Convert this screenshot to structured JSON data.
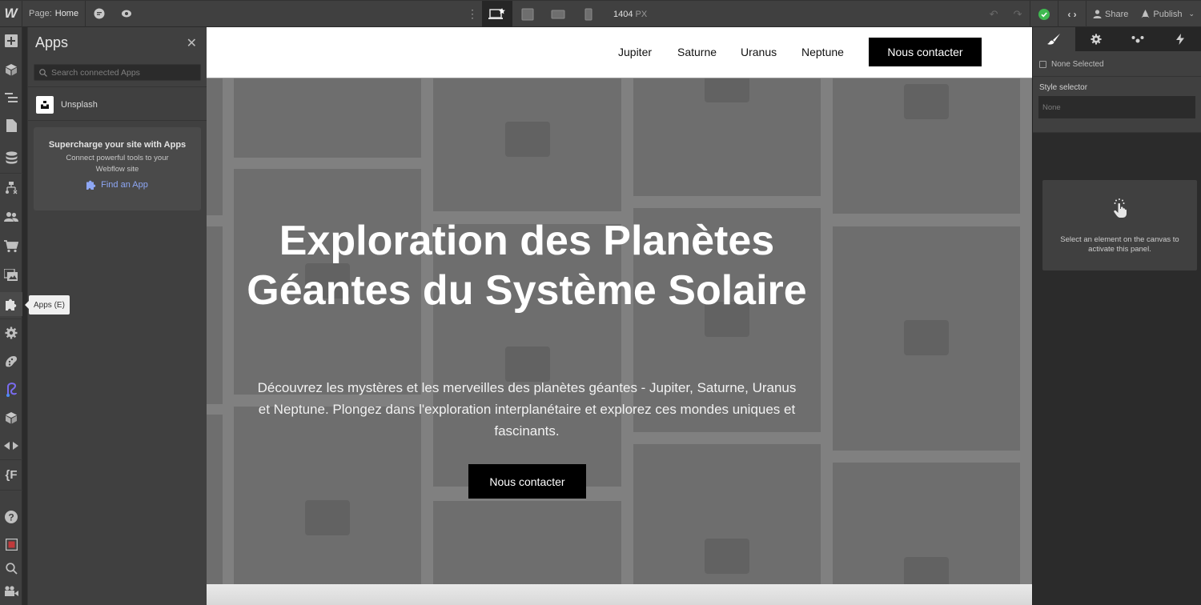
{
  "topbar": {
    "logo": "W",
    "page_label": "Page:",
    "page_name": "Home",
    "breakpoints": [
      {
        "name": "desktop-base",
        "active": true
      },
      {
        "name": "tablet",
        "active": false
      },
      {
        "name": "mobile-landscape",
        "active": false
      },
      {
        "name": "mobile-portrait",
        "active": false
      }
    ],
    "width_value": "1404",
    "width_unit": "PX",
    "share_label": "Share",
    "publish_label": "Publish",
    "status_color": "#3fb950"
  },
  "rail": {
    "items": [
      "add",
      "components",
      "navigator",
      "pages",
      "cms",
      "logic",
      "users",
      "ecommerce",
      "assets",
      "apps",
      "settings",
      "style-guide",
      "audit",
      "3d",
      "code",
      "finsweet",
      "help",
      "record",
      "search",
      "video"
    ],
    "tooltip": "Apps (E)"
  },
  "apps_panel": {
    "title": "Apps",
    "search_placeholder": "Search connected Apps",
    "search_value": "",
    "installed": [
      {
        "name": "Unsplash"
      }
    ],
    "promo_title": "Supercharge your site with Apps",
    "promo_desc": "Connect powerful tools to your Webflow site",
    "promo_link": "Find an App",
    "accent": "#8ea7f5"
  },
  "site": {
    "nav_links": [
      "Jupiter",
      "Saturne",
      "Uranus",
      "Neptune"
    ],
    "nav_cta": "Nous contacter",
    "hero_title": "Exploration des Planètes Géantes du Système Solaire",
    "hero_text": "Découvrez les mystères et les merveilles des planètes géantes - Jupiter, Saturne, Uranus et Neptune. Plongez dans l'exploration interplanétaire et explorez ces mondes uniques et fascinants.",
    "hero_cta": "Nous contacter"
  },
  "right_panel": {
    "tabs": [
      "style",
      "settings",
      "interactions-ix",
      "interactions"
    ],
    "none_selected": "None Selected",
    "style_selector_label": "Style selector",
    "style_selector_value": "None",
    "empty_text": "Select an element on the canvas to activate this panel."
  }
}
